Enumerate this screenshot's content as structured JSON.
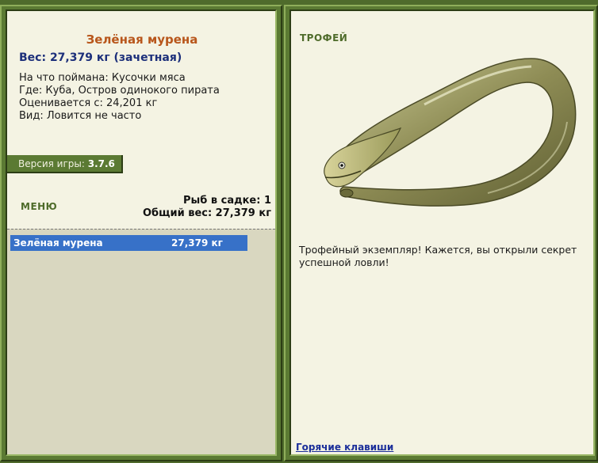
{
  "fish": {
    "name": "Зелёная мурена",
    "weight_line": "Вес: 27,379 кг (зачетная)",
    "bait_line": "На что поймана: Кусочки мяса",
    "location_line": "Где: Куба, Остров одинокого пирата",
    "value_line": "Оценивается с: 24,201 кг",
    "rarity_line": "Вид: Ловится не часто"
  },
  "version": {
    "label": "Версия игры:",
    "value": "3.7.6"
  },
  "menu": {
    "label": "МЕНЮ"
  },
  "keepnet": {
    "count_line": "Рыб в садке: 1",
    "total_line": "Общий вес: 27,379 кг",
    "rows": [
      {
        "name": "Зелёная мурена",
        "weight": "27,379 кг"
      }
    ]
  },
  "trophy": {
    "label": "ТРОФЕЙ",
    "text": "Трофейный экземпляр! Кажется, вы открыли секрет успешной ловли!"
  },
  "hotkeys": {
    "label": "Горячие клавиши"
  },
  "colors": {
    "frame": "#5b7a33",
    "panel": "#f4f3e3",
    "title": "#b8561b",
    "weight": "#1c2f7a",
    "selection": "#3771c8",
    "catch_area": "#d9d7c0"
  }
}
